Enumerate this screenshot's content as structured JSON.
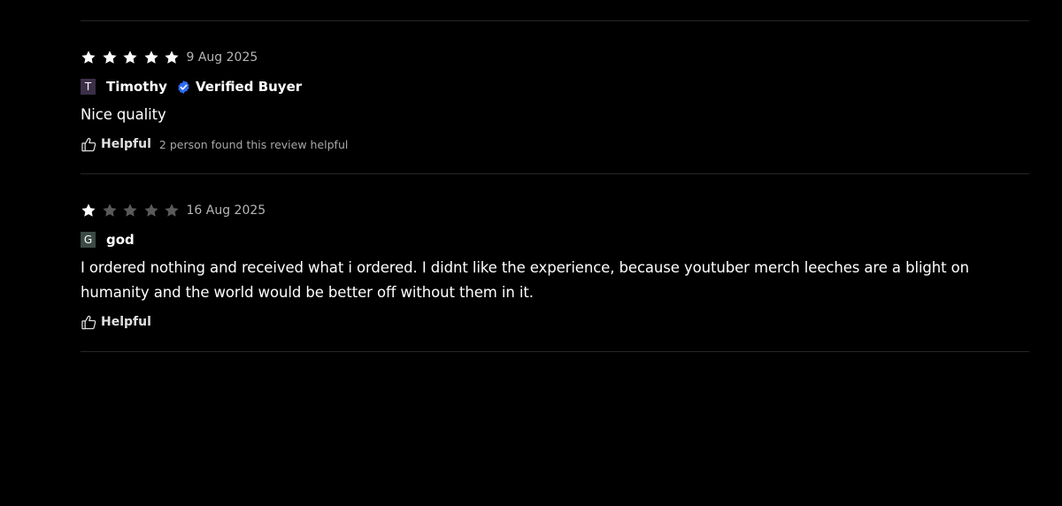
{
  "colors": {
    "background": "#000000",
    "star_filled": "#ffffff",
    "star_empty": "#5a5a5a",
    "verified_badge": "#2f6cf5",
    "divider": "#262626"
  },
  "reviews": [
    {
      "rating": 5,
      "max_rating": 5,
      "date": "9 Aug 2025",
      "avatar_letter": "T",
      "avatar_color": "#3a2f47",
      "author": "Timothy",
      "verified_label": "Verified Buyer",
      "verified_icon": "check-badge-icon",
      "body": "Nice quality",
      "helpful_label": "Helpful",
      "helpful_icon": "thumbs-up-icon",
      "helpful_count_text": "2 person found this review helpful"
    },
    {
      "rating": 1,
      "max_rating": 5,
      "date": "16 Aug 2025",
      "avatar_letter": "G",
      "avatar_color": "#3b4a44",
      "author": "god",
      "body": "I ordered nothing and received what i ordered. I didnt like the experience, because youtuber merch leeches are a blight on humanity and the world would be better off without them in it.",
      "helpful_label": "Helpful",
      "helpful_icon": "thumbs-up-icon"
    }
  ]
}
